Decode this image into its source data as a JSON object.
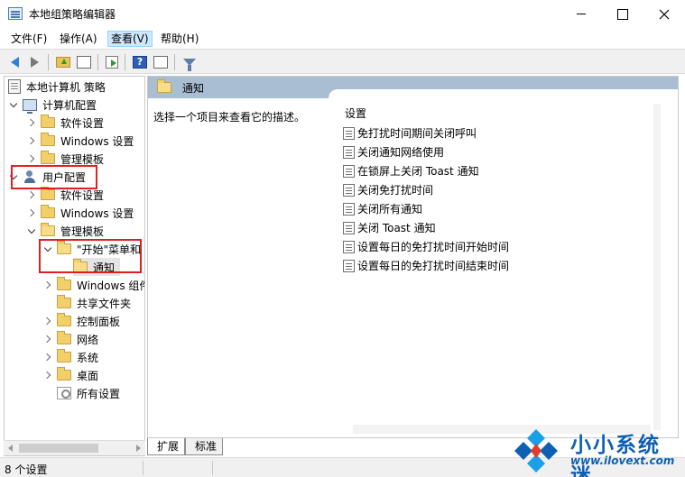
{
  "window": {
    "title": "本地组策略编辑器"
  },
  "menu": {
    "items": [
      "文件(F)",
      "操作(A)",
      "查看(V)",
      "帮助(H)"
    ]
  },
  "tree": {
    "root": "本地计算机 策略",
    "computer_config": "计算机配置",
    "cc_software": "软件设置",
    "cc_windows": "Windows 设置",
    "cc_admin": "管理模板",
    "user_config": "用户配置",
    "uc_software": "软件设置",
    "uc_windows": "Windows 设置",
    "uc_admin": "管理模板",
    "start_menu": "\"开始\"菜单和",
    "notifications": "通知",
    "windows_components": "Windows 组件",
    "shared_folders": "共享文件夹",
    "control_panel": "控制面板",
    "network": "网络",
    "system": "系统",
    "desktop": "桌面",
    "all_settings": "所有设置"
  },
  "right": {
    "header_title": "通知",
    "description": "选择一个项目来查看它的描述。",
    "column_header": "设置",
    "items": [
      "免打扰时间期间关闭呼叫",
      "关闭通知网络使用",
      "在锁屏上关闭 Toast 通知",
      "关闭免打扰时间",
      "关闭所有通知",
      "关闭 Toast 通知",
      "设置每日的免打扰时间开始时间",
      "设置每日的免打扰时间结束时间"
    ]
  },
  "tabs": {
    "extended": "扩展",
    "standard": "标准"
  },
  "status": {
    "text": "8 个设置"
  },
  "watermark": {
    "title": "小小系统迷",
    "url": "www.ilovext.com"
  },
  "colors": {
    "header_blue": "#a9bdd3",
    "highlight_red": "#e02020",
    "watermark_blue": "#0f5fb3"
  }
}
